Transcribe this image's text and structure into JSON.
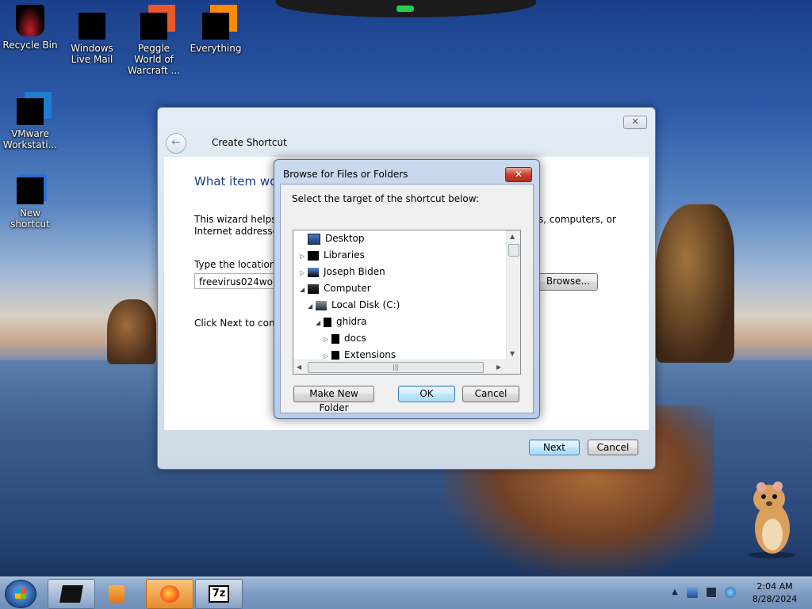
{
  "desktop": {
    "icons": [
      {
        "label": "Recycle Bin",
        "icon": "recycle-bin-icon"
      },
      {
        "label": "Windows Live Mail",
        "icon": "windows-live-mail-icon"
      },
      {
        "label": "Peggle World of Warcraft ...",
        "icon": "peggle-icon"
      },
      {
        "label": "Everything",
        "icon": "everything-icon"
      },
      {
        "label": "VMware Workstati...",
        "icon": "vmware-icon"
      },
      {
        "label": "New shortcut",
        "icon": "shortcut-icon"
      }
    ]
  },
  "wizard": {
    "close_label": "✕",
    "back_icon": "←",
    "title": "Create Shortcut",
    "heading": "What item wou",
    "description": "This wizard helps y",
    "description_tail": "s, computers, or",
    "description_line2": "Internet addresses.",
    "location_label": "Type the location o",
    "location_value": "freevirus024wokin",
    "browse_label": "Browse...",
    "next_text": "Click Next to contir",
    "next_button": "Next",
    "cancel_button": "Cancel"
  },
  "browse_dialog": {
    "title": "Browse for Files or Folders",
    "close_label": "✕",
    "prompt": "Select the target of the shortcut below:",
    "tree": [
      {
        "label": "Desktop",
        "expander": "",
        "icon": "desktop-icon"
      },
      {
        "label": "Libraries",
        "expander": "▷",
        "icon": "libraries-icon"
      },
      {
        "label": "Joseph Biden",
        "expander": "▷",
        "icon": "user-folder-icon"
      },
      {
        "label": "Computer",
        "expander": "◢",
        "icon": "computer-icon"
      },
      {
        "label": "Local Disk (C:)",
        "expander": "◢",
        "icon": "disk-icon"
      },
      {
        "label": "ghidra",
        "expander": "◢",
        "icon": "folder-icon"
      },
      {
        "label": "docs",
        "expander": "▷",
        "icon": "folder-icon"
      },
      {
        "label": "Extensions",
        "expander": "▷",
        "icon": "folder-icon"
      }
    ],
    "make_new_folder": "Make New Folder",
    "ok": "OK",
    "cancel": "Cancel"
  },
  "taskbar": {
    "pinned": [
      {
        "name": "black-app-icon"
      },
      {
        "name": "media-player-icon"
      },
      {
        "name": "firefox-icon"
      },
      {
        "name": "7zip-icon",
        "label": "7z"
      }
    ],
    "tray": {
      "show_hidden": "▲",
      "time": "2:04 AM",
      "date": "8/28/2024"
    }
  }
}
